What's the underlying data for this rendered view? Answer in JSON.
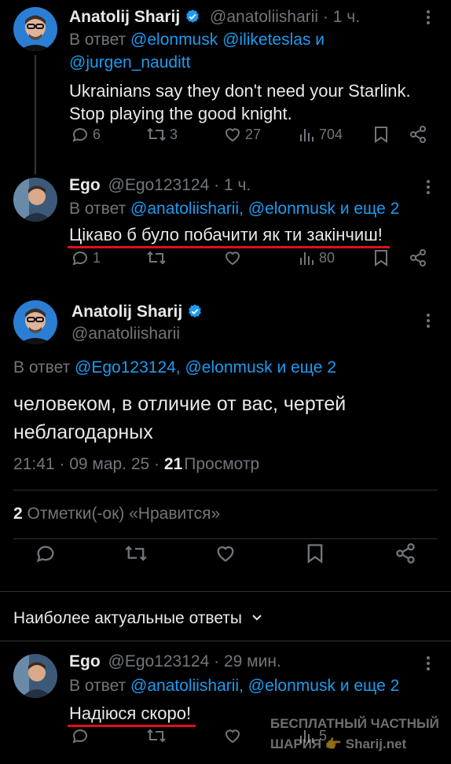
{
  "tweet1": {
    "name": "Anatolij Sharij",
    "handle": "@anatoliisharii",
    "time": "· 1 ч.",
    "reply_prefix": "В ответ",
    "reply_mention1": "@elonmusk",
    "reply_mention2": "@iliketeslas",
    "reply_and": "и",
    "reply_mention3": "@jurgen_nauditt",
    "text_line1": "Ukrainians say they don't need your Starlink.",
    "text_line2": "Stop playing the good knight.",
    "replies": "6",
    "retweets": "3",
    "likes": "27",
    "views": "704"
  },
  "tweet2": {
    "name": "Ego",
    "handle": "@Ego123124",
    "time": "· 1 ч.",
    "reply_prefix": "В ответ",
    "reply_mentions": "@anatoliisharii, @elonmusk",
    "reply_more": "и еще 2",
    "text": "Цікаво б було побачити як ти закінчиш!",
    "replies": "1",
    "views": "80"
  },
  "main": {
    "name": "Anatolij Sharij",
    "handle": "@anatoliisharii",
    "reply_prefix": "В ответ",
    "reply_mentions": "@Ego123124, @elonmusk",
    "reply_more": "и еще 2",
    "text_line1": "человеком, в отличие от вас, чертей",
    "text_line2": "неблагодарных",
    "timestamp": "21:41 · 09 мар. 25 ·",
    "views_count": "21",
    "views_label": "Просмотр",
    "likes_count": "2",
    "likes_label": "Отметки(-ок) «Нравится»"
  },
  "sort": {
    "label": "Наиболее актуальные ответы",
    "chevron": "⌄"
  },
  "tweet3": {
    "name": "Ego",
    "handle": "@Ego123124",
    "time": "· 29 мин.",
    "reply_prefix": "В ответ",
    "reply_mentions": "@anatoliisharii, @elonmusk",
    "reply_more": "и еще 2",
    "text": "Надіюся скоро!",
    "views": "5"
  },
  "watermark": {
    "line1": "БЕСПЛАТНЫЙ ЧАСТНЫЙ",
    "line2": "ШАРИЯ 👉 Sharij.net"
  },
  "colors": {
    "background": "#000000",
    "text": "#e7e9ea",
    "secondary": "#71767b",
    "accent": "#1d9bf0",
    "underline": "#e0101a"
  }
}
